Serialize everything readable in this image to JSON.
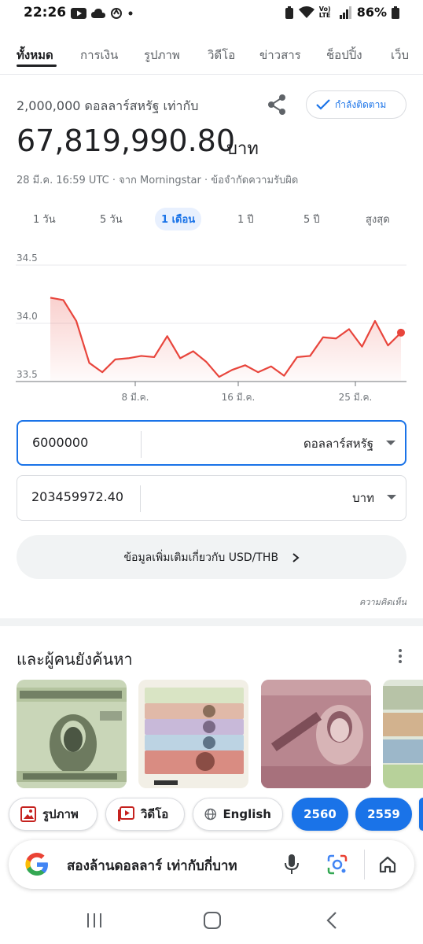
{
  "status_bar": {
    "time": "22:26",
    "battery": "86%",
    "network_label": "Vo) LTE"
  },
  "tabs": [
    {
      "label": "ทั้งหมด",
      "active": true
    },
    {
      "label": "การเงิน"
    },
    {
      "label": "รูปภาพ"
    },
    {
      "label": "วิดีโอ"
    },
    {
      "label": "ข่าวสาร"
    },
    {
      "label": "ช็อปปิ้ง"
    },
    {
      "label": "เว็บ"
    }
  ],
  "converter": {
    "title": "2,000,000 ดอลลาร์สหรัฐ เท่ากับ",
    "result_value": "67,819,990.80",
    "result_unit": "บาท",
    "follow_label": "กำลังติดตาม",
    "meta": "28 มี.ค. 16:59 UTC · จาก Morningstar · ข้อจำกัดความรับผิด",
    "ranges": [
      {
        "label": "1 วัน"
      },
      {
        "label": "5 วัน"
      },
      {
        "label": "1 เดือน",
        "active": true
      },
      {
        "label": "1 ปี"
      },
      {
        "label": "5 ปี"
      },
      {
        "label": "สูงสุด"
      }
    ],
    "from_amount": "6000000",
    "from_currency": "ดอลลาร์สหรัฐ",
    "to_amount": "203459972.40",
    "to_currency": "บาท",
    "more_info": "ข้อมูลเพิ่มเติมเกี่ยวกับ USD/THB",
    "feedback": "ความคิดเห็น"
  },
  "chart_data": {
    "type": "line",
    "y_ticks": [
      "34.5",
      "34.0",
      "33.5"
    ],
    "ylim": [
      33.5,
      34.5
    ],
    "x_ticks": [
      "8 มี.ค.",
      "16 มี.ค.",
      "25 มี.ค."
    ],
    "values": [
      34.22,
      34.2,
      34.02,
      33.66,
      33.58,
      33.69,
      33.7,
      33.72,
      33.71,
      33.89,
      33.7,
      33.76,
      33.67,
      33.54,
      33.6,
      33.64,
      33.58,
      33.63,
      33.55,
      33.71,
      33.72,
      33.88,
      33.87,
      33.95,
      33.8,
      34.02,
      33.81,
      33.92
    ],
    "line_color": "#e8453c",
    "fill_color": "#fce8e6"
  },
  "people_also_search": {
    "title": "และผู้คนยังค้นหา"
  },
  "bottom_chips": [
    {
      "label": "รูปภาพ",
      "icon": "image-icon"
    },
    {
      "label": "วิดีโอ",
      "icon": "video-icon"
    },
    {
      "label": "English",
      "icon": "globe-icon"
    },
    {
      "label": "2560"
    },
    {
      "label": "2559"
    }
  ],
  "search": {
    "query": "สองล้านดอลลาร์ เท่ากับกี่บาท"
  }
}
